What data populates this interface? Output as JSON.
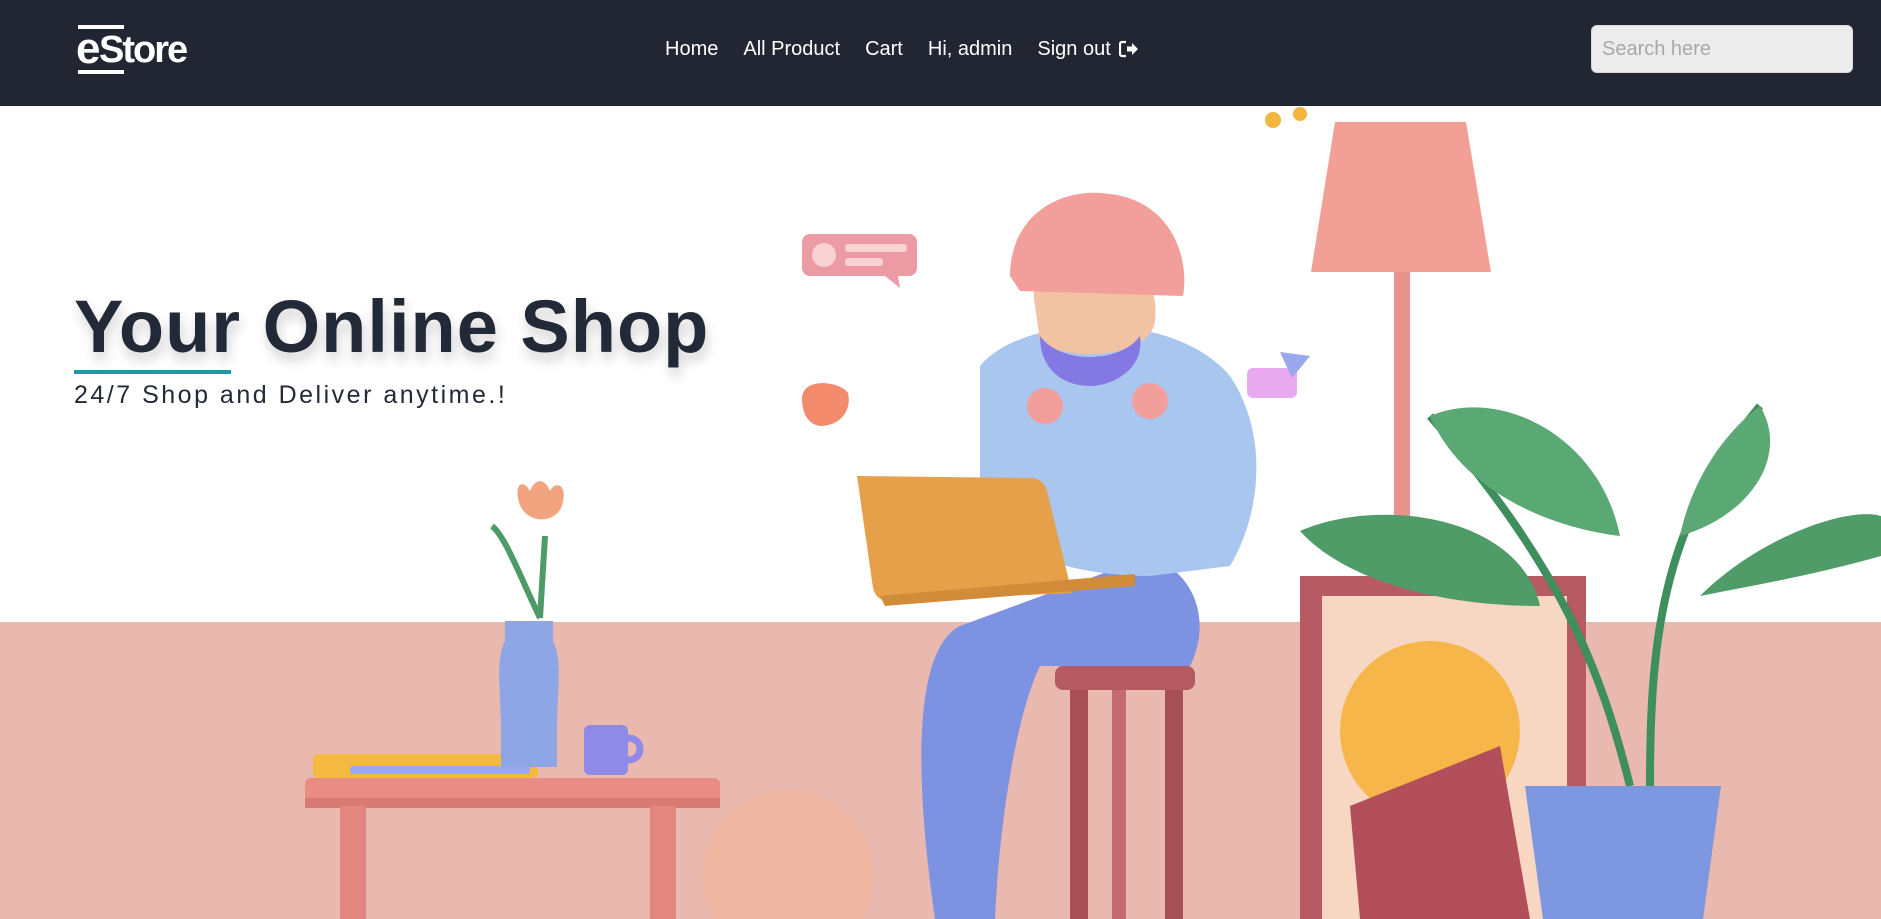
{
  "header": {
    "logo_text_e": "e",
    "logo_text_rest": "Store",
    "nav": {
      "home": "Home",
      "all_product": "All Product",
      "cart": "Cart",
      "greeting": "Hi, admin",
      "sign_out": "Sign out"
    },
    "search": {
      "placeholder": "Search here",
      "value": ""
    }
  },
  "hero": {
    "title": "Your Online Shop",
    "subtitle": "24/7 Shop and Deliver anytime.!"
  },
  "colors": {
    "navbar": "#212632",
    "accent_underline": "#1c9aa6",
    "floor": "#e9b8ae",
    "title": "#222a38"
  },
  "icons": {
    "sign_out": "sign-out-icon"
  }
}
